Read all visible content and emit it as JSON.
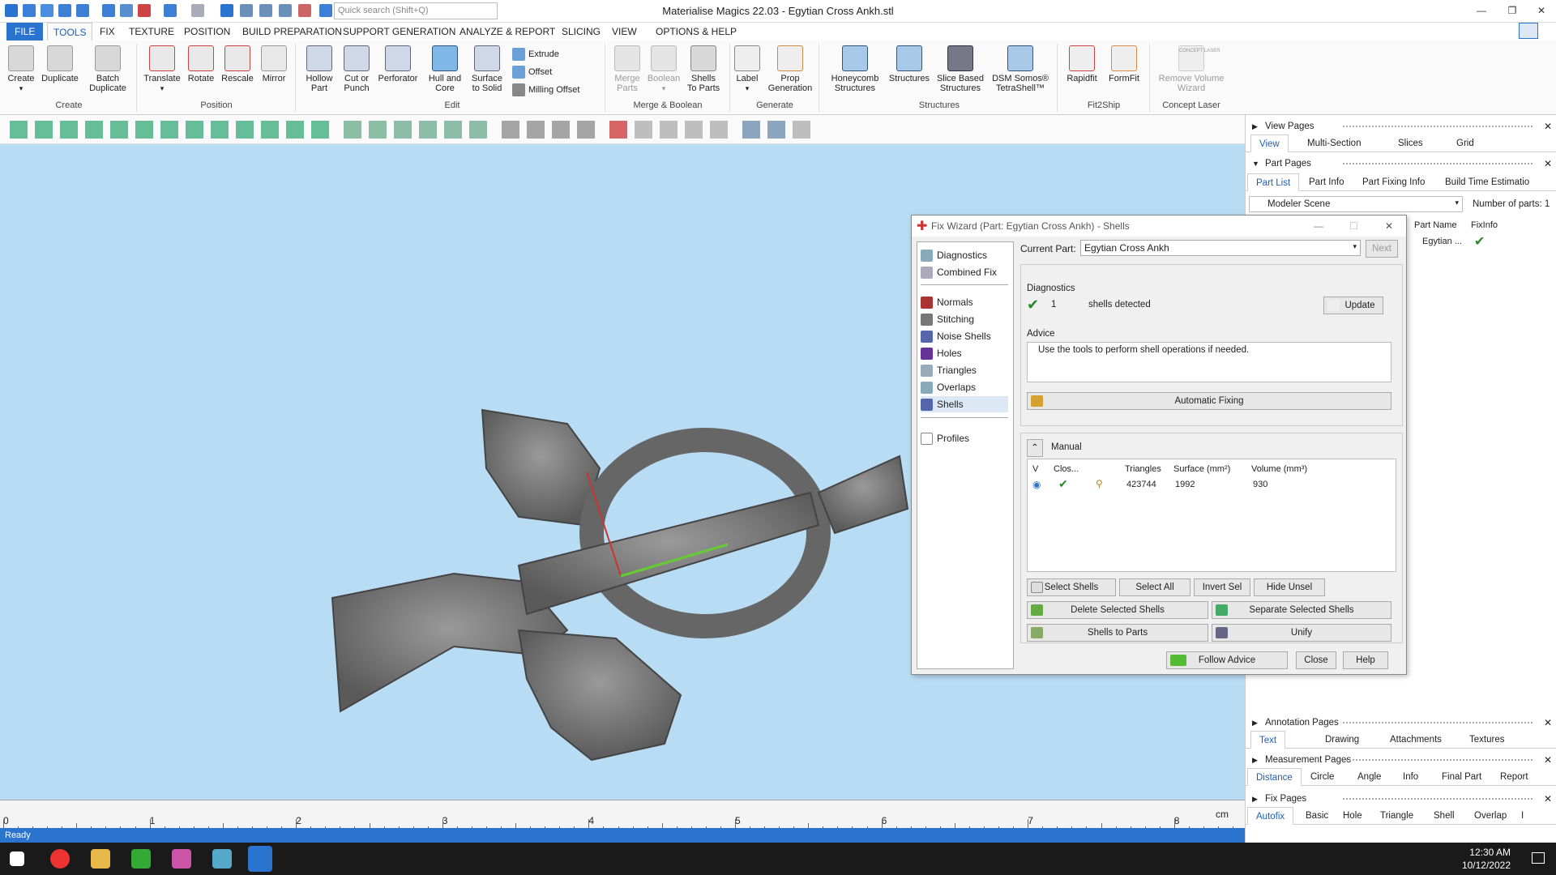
{
  "app": {
    "title": "Materialise Magics 22.03 - Egytian Cross  Ankh.stl",
    "search_placeholder": "Quick search (Shift+Q)",
    "status": "Ready"
  },
  "ribbon_tabs": [
    "FILE",
    "TOOLS",
    "FIX",
    "TEXTURE",
    "POSITION",
    "BUILD PREPARATION",
    "SUPPORT GENERATION",
    "ANALYZE & REPORT",
    "SLICING",
    "VIEW",
    "OPTIONS & HELP"
  ],
  "ribbon": {
    "create": [
      "Create",
      "Duplicate",
      "Batch\nDuplicate"
    ],
    "create_group": "Create",
    "position": [
      "Translate",
      "Rotate",
      "Rescale",
      "Mirror"
    ],
    "position_group": "Position",
    "edit": [
      "Hollow\nPart",
      "Cut or\nPunch",
      "Perforator",
      "Hull and\nCore",
      "Surface\nto Solid"
    ],
    "edit_small": [
      "Extrude",
      "Offset",
      "Milling Offset"
    ],
    "edit_group": "Edit",
    "merge": [
      "Merge\nParts",
      "Boolean",
      "Shells\nTo Parts"
    ],
    "merge_group": "Merge & Boolean",
    "generate": [
      "Label",
      "Prop\nGeneration"
    ],
    "generate_group": "Generate",
    "structures": [
      "Honeycomb\nStructures",
      "Structures",
      "Slice Based\nStructures",
      "DSM Somos®\nTetraShell™"
    ],
    "structures_group": "Structures",
    "fit2ship": [
      "Rapidfit",
      "FormFit"
    ],
    "fit2ship_group": "Fit2Ship",
    "concept": [
      "Remove Volume\nWizard"
    ],
    "concept_group": "Concept Laser",
    "concept_logo": "CONCEPT LASER"
  },
  "ruler": {
    "labels": [
      "0",
      "1",
      "2",
      "3",
      "4",
      "5",
      "6",
      "7",
      "8"
    ],
    "unit": "cm"
  },
  "panel": {
    "view_pages": "View Pages",
    "view_tabs": [
      "View",
      "Multi-Section",
      "Slices",
      "Grid"
    ],
    "part_pages": "Part Pages",
    "part_tabs": [
      "Part List",
      "Part Info",
      "Part Fixing Info",
      "Build Time Estimatio"
    ],
    "scene": "Modeler Scene",
    "num_parts_label": "Number of parts:",
    "num_parts": "1",
    "col_name": "Part Name",
    "col_fix": "FixInfo",
    "part_name": "Egytian ...",
    "annotation_pages": "Annotation Pages",
    "annotation_tabs": [
      "Text",
      "Drawing",
      "Attachments",
      "Textures"
    ],
    "measurement_pages": "Measurement Pages",
    "measurement_tabs": [
      "Distance",
      "Circle",
      "Angle",
      "Info",
      "Final Part",
      "Report"
    ],
    "fix_pages": "Fix Pages",
    "fix_tabs": [
      "Autofix",
      "Basic",
      "Hole",
      "Triangle",
      "Shell",
      "Overlap",
      "I"
    ]
  },
  "dialog": {
    "title": "Fix Wizard (Part: Egytian Cross  Ankh) - Shells",
    "nav_top": [
      "Diagnostics",
      "Combined Fix"
    ],
    "nav_mid": [
      "Normals",
      "Stitching",
      "Noise Shells",
      "Holes",
      "Triangles",
      "Overlaps",
      "Shells"
    ],
    "nav_bottom": [
      "Profiles"
    ],
    "current_part_label": "Current Part:",
    "current_part": "Egytian Cross  Ankh",
    "next": "Next",
    "diag_title": "Diagnostics",
    "diag_count": "1",
    "diag_text": "shells detected",
    "update": "Update",
    "advice_title": "Advice",
    "advice_text": "Use the tools to perform shell operations if needed.",
    "auto_fix": "Automatic Fixing",
    "manual": "Manual",
    "table_headers": [
      "V",
      "Clos...",
      "",
      "Triangles",
      "Surface (mm²)",
      "Volume (mm³)"
    ],
    "row": {
      "triangles": "423744",
      "surface": "1992",
      "volume": "930"
    },
    "buttons": [
      "Select Shells",
      "Select All",
      "Invert Sel",
      "Hide Unsel"
    ],
    "buttons2": [
      "Delete Selected Shells",
      "Separate Selected Shells"
    ],
    "buttons3": [
      "Shells to Parts",
      "Unify"
    ],
    "follow": "Follow Advice",
    "close": "Close",
    "help": "Help"
  },
  "taskbar": {
    "time": "12:30 AM",
    "date": "10/12/2022"
  },
  "colors": {
    "accent": "#2a74d0",
    "viewport": "#b9dcf5",
    "check": "#2a8a2a"
  }
}
